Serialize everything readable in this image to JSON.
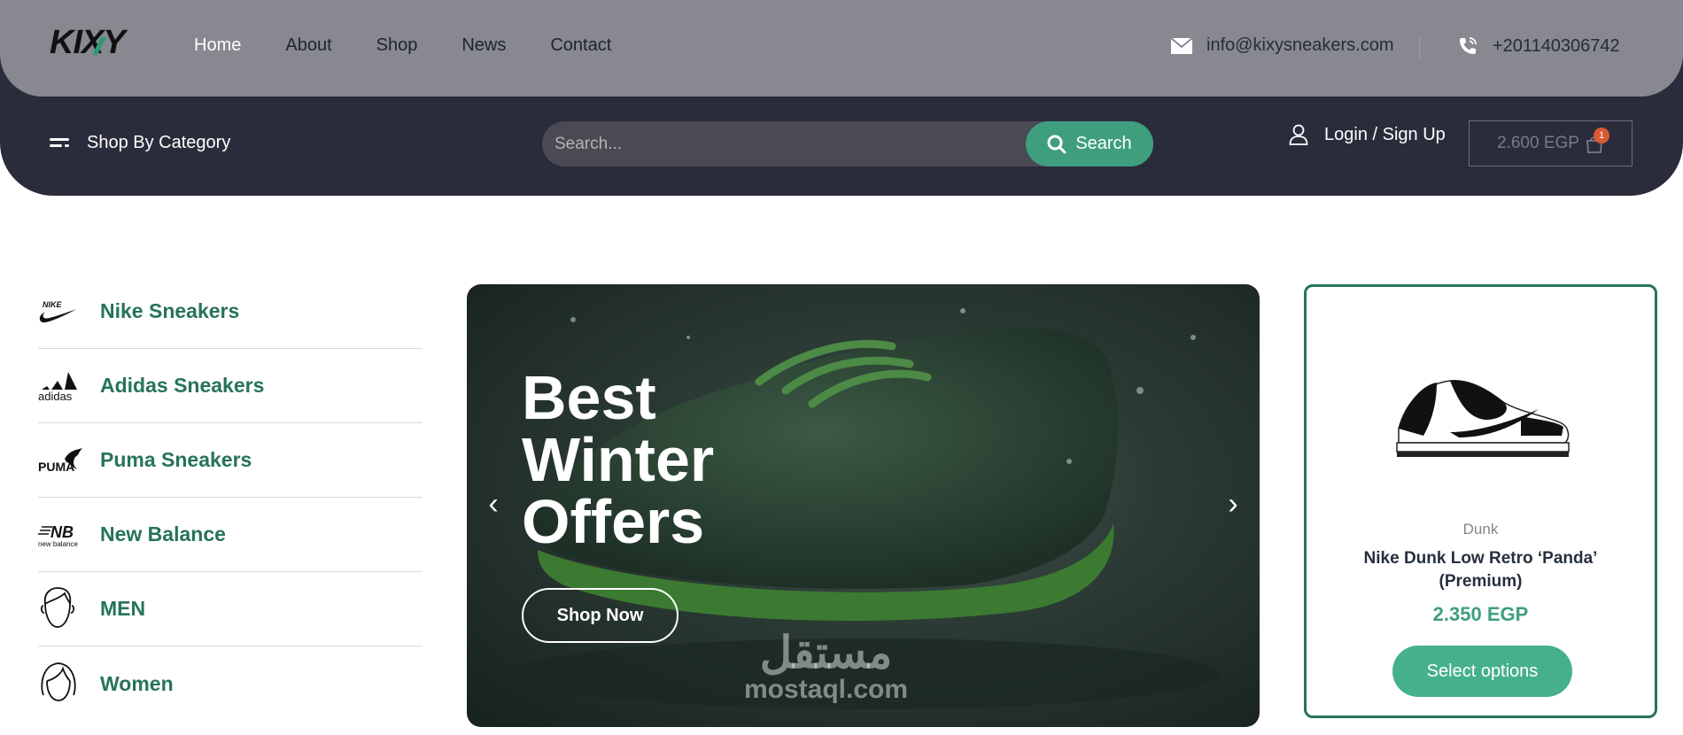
{
  "brand": {
    "logo_text": "KIXY"
  },
  "nav": [
    {
      "label": "Home"
    },
    {
      "label": "About"
    },
    {
      "label": "Shop"
    },
    {
      "label": "News"
    },
    {
      "label": "Contact"
    }
  ],
  "contact": {
    "email": "info@kixysneakers.com",
    "phone": "+201140306742"
  },
  "toolbar": {
    "category_label": "Shop By Category",
    "search_placeholder": "Search...",
    "search_button": "Search",
    "login_label": "Login / Sign Up",
    "cart_total": "2.600 EGP",
    "cart_count": "1"
  },
  "categories": [
    {
      "label": "Nike Sneakers",
      "icon": "nike-logo-icon"
    },
    {
      "label": "Adidas Sneakers",
      "icon": "adidas-logo-icon"
    },
    {
      "label": "Puma Sneakers",
      "icon": "puma-logo-icon"
    },
    {
      "label": "New Balance",
      "icon": "new-balance-logo-icon"
    },
    {
      "label": "MEN",
      "icon": "man-face-icon"
    },
    {
      "label": "Women",
      "icon": "woman-face-icon"
    }
  ],
  "hero": {
    "title_line1": "Best",
    "title_line2": "Winter",
    "title_line3": "Offers",
    "cta": "Shop Now",
    "watermark_ar": "مستقل",
    "watermark_en": "mostaql.com"
  },
  "featured_product": {
    "category": "Dunk",
    "name": "Nike Dunk Low Retro ‘Panda’ (Premium)",
    "price": "2.350 EGP",
    "button": "Select options"
  },
  "colors": {
    "accent_green": "#3f9e7e",
    "header_dark": "#2b2c3b",
    "topbar_gray": "#878890",
    "category_text": "#26735a",
    "badge": "#d95a32"
  }
}
